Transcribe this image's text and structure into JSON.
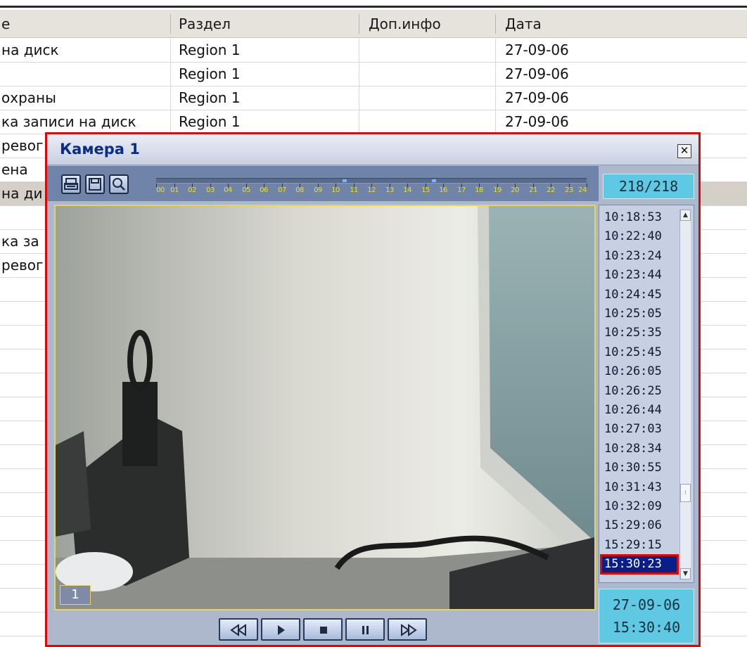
{
  "table": {
    "columns": [
      "е",
      "Раздел",
      "Доп.инфо",
      "Дата"
    ],
    "rows": [
      {
        "event": "на диск",
        "section": "Region 1",
        "info": "",
        "date": "27-09-06"
      },
      {
        "event": "",
        "section": "Region 1",
        "info": "",
        "date": "27-09-06"
      },
      {
        "event": " охраны",
        "section": "Region 1",
        "info": "",
        "date": "27-09-06"
      },
      {
        "event": "ка записи на диск",
        "section": "Region 1",
        "info": "",
        "date": "27-09-06"
      },
      {
        "event": "ревог",
        "section": "",
        "info": "",
        "date": ""
      },
      {
        "event": "ена",
        "section": "",
        "info": "",
        "date": ""
      },
      {
        "event": "на ди",
        "section": "",
        "info": "",
        "date": ""
      },
      {
        "event": "",
        "section": "",
        "info": "",
        "date": ""
      },
      {
        "event": "ка за",
        "section": "",
        "info": "",
        "date": ""
      },
      {
        "event": "ревог",
        "section": "",
        "info": "",
        "date": ""
      }
    ]
  },
  "camera_window": {
    "title": "Камера 1",
    "close_glyph": "✕",
    "counter": "218/218",
    "camera_number": "1",
    "timeline_hours": [
      "00",
      "01",
      "02",
      "03",
      "04",
      "05",
      "06",
      "07",
      "08",
      "09",
      "10",
      "11",
      "12",
      "13",
      "14",
      "15",
      "16",
      "17",
      "18",
      "19",
      "20",
      "21",
      "22",
      "23",
      "24"
    ],
    "times": [
      "10:18:53",
      "10:22:40",
      "10:23:24",
      "10:23:44",
      "10:24:45",
      "10:25:05",
      "10:25:35",
      "10:25:45",
      "10:26:05",
      "10:26:25",
      "10:26:44",
      "10:27:03",
      "10:28:34",
      "10:30:55",
      "10:31:43",
      "10:32:09",
      "15:29:06",
      "15:29:15",
      "15:30:23"
    ],
    "selected_time": "15:30:23",
    "date": "27-09-06",
    "time": "15:30:40",
    "colors": {
      "frame": "#d30b0b",
      "accent": "#5fc9e3",
      "title": "#0c2c85"
    }
  }
}
